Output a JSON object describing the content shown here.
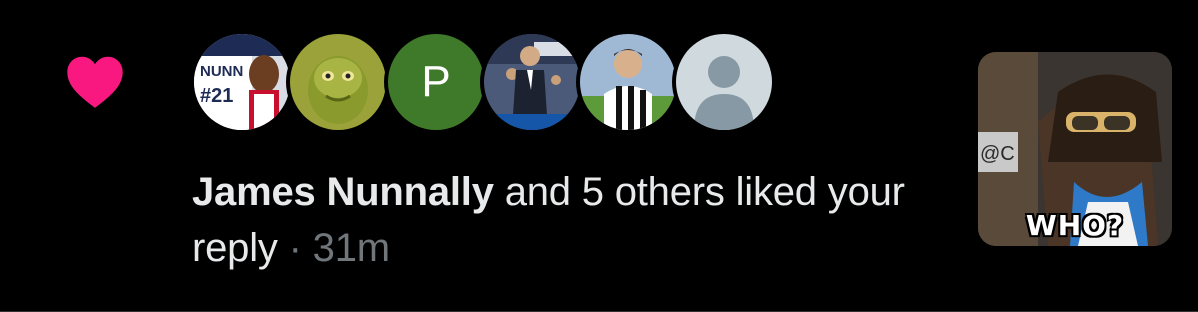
{
  "notification": {
    "type_icon": "heart-icon",
    "accent_color": "#f91880",
    "actor_name": "James Nunnally",
    "action_text": " and 5 others liked your reply",
    "separator": " · ",
    "timestamp": "31m",
    "avatars": [
      {
        "name": "avatar-james-nunnally",
        "jersey_text": "NUNN",
        "jersey_number": "#21"
      },
      {
        "name": "avatar-grinch"
      },
      {
        "name": "avatar-p",
        "letter": "P",
        "color": "#3f7a2a"
      },
      {
        "name": "avatar-suited-man"
      },
      {
        "name": "avatar-soccer-player"
      },
      {
        "name": "avatar-default",
        "icon": "default-user-icon"
      }
    ],
    "media": {
      "caption": "WHO?",
      "overlay_text": "@C"
    }
  }
}
